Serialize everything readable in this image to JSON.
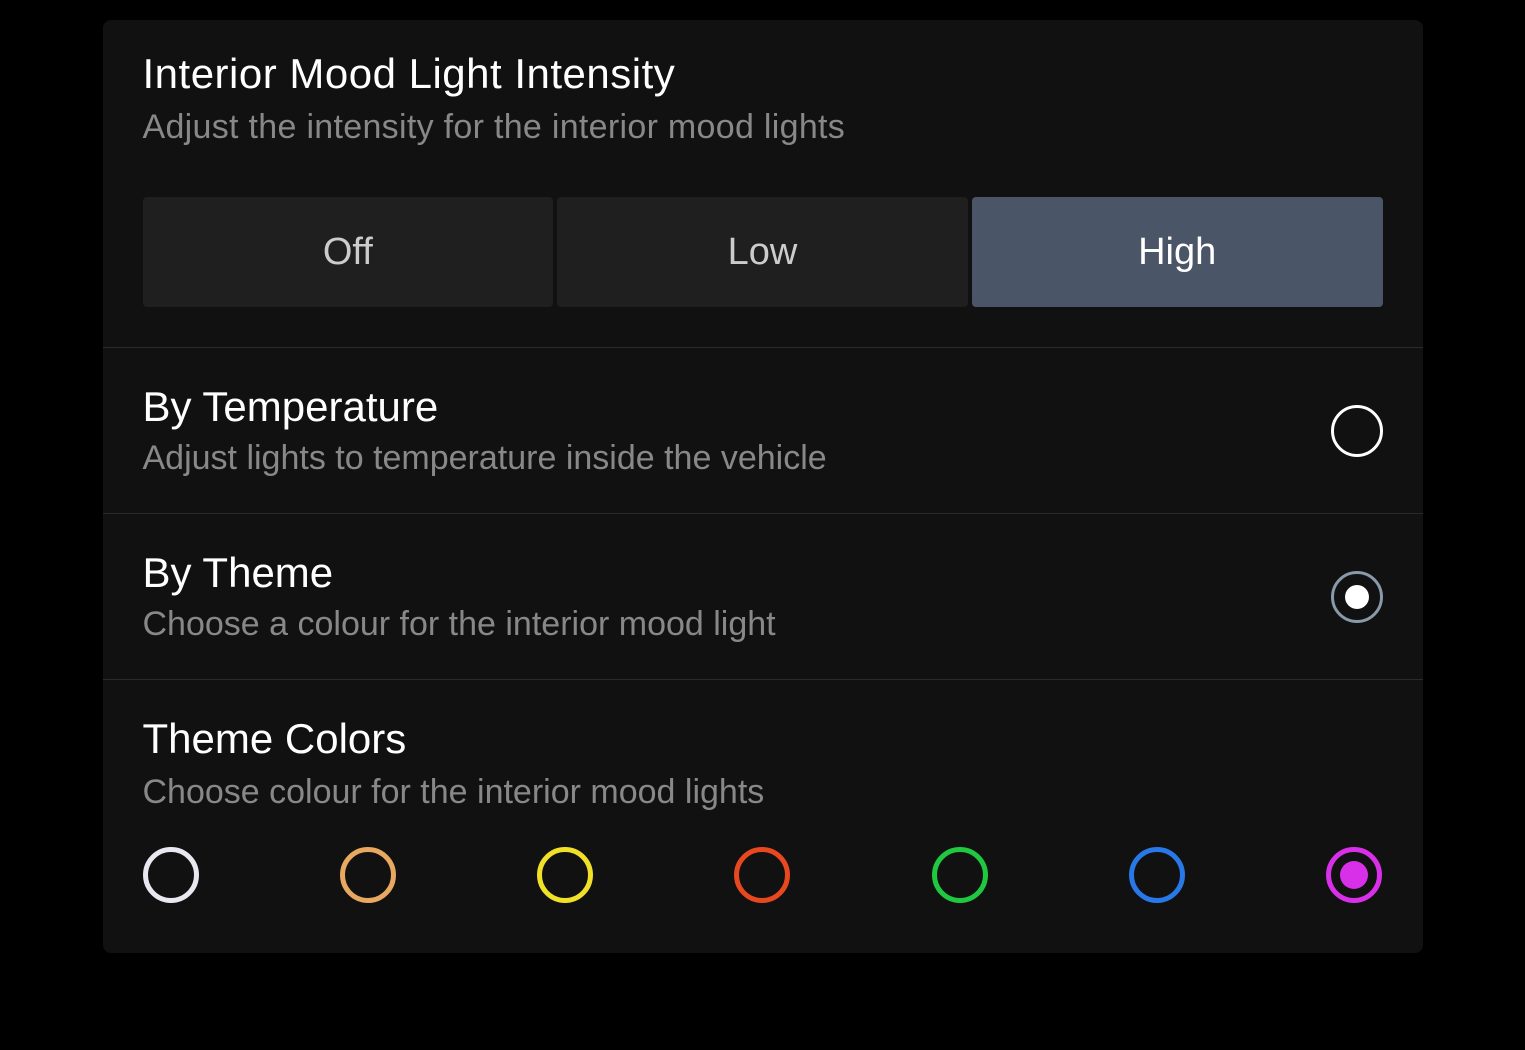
{
  "intensity": {
    "title": "Interior Mood Light Intensity",
    "subtitle": "Adjust the intensity for the interior mood lights",
    "options": {
      "off": "Off",
      "low": "Low",
      "high": "High"
    },
    "selected": "high"
  },
  "byTemperature": {
    "title": "By Temperature",
    "subtitle": "Adjust lights to temperature inside the vehicle",
    "selected": false
  },
  "byTheme": {
    "title": "By Theme",
    "subtitle": "Choose a colour for the interior mood light",
    "selected": true
  },
  "themeColors": {
    "title": "Theme Colors",
    "subtitle": "Choose colour for the interior mood lights",
    "colors": [
      {
        "name": "white",
        "hex": "#e8e8f0",
        "selected": false
      },
      {
        "name": "orange",
        "hex": "#e8a860",
        "selected": false
      },
      {
        "name": "yellow",
        "hex": "#f0e028",
        "selected": false
      },
      {
        "name": "red",
        "hex": "#e84820",
        "selected": false
      },
      {
        "name": "green",
        "hex": "#20c840",
        "selected": false
      },
      {
        "name": "blue",
        "hex": "#2878e8",
        "selected": false
      },
      {
        "name": "magenta",
        "hex": "#d830e8",
        "selected": true
      }
    ]
  }
}
